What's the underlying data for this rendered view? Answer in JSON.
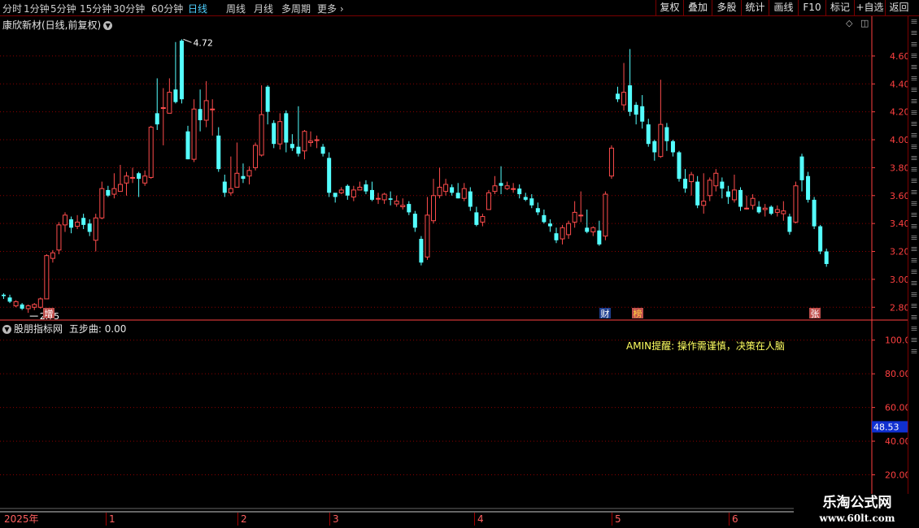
{
  "toolbar": {
    "periods": [
      "分时",
      "1分钟",
      "5分钟",
      "15分钟",
      "30分钟",
      "60分钟",
      "日线",
      "周线",
      "月线",
      "多周期",
      "更多"
    ],
    "active_period": "日线",
    "buttons": [
      "复权",
      "叠加",
      "多股",
      "统计",
      "画线",
      "F10",
      "标记",
      "+自选",
      "返回"
    ]
  },
  "main_chart": {
    "title": "康欣新材(日线,前复权)",
    "high_label": "4.72",
    "low_label": "2.75",
    "markers": [
      "增",
      "财",
      "榜",
      "张"
    ],
    "price_ticks": [
      "4.60",
      "4.40",
      "4.20",
      "4.00",
      "3.80",
      "3.60",
      "3.40",
      "3.20",
      "3.00",
      "2.80"
    ]
  },
  "indicator": {
    "title": "股朋指标网",
    "series_label": "五步曲: 0.00",
    "reminder": "AMIN提醒: 操作需谨慎，决策在人脑",
    "ticks": [
      "100.00",
      "80.00",
      "60.00",
      "40.00",
      "20.00"
    ],
    "current_value": "48.53"
  },
  "date_axis": [
    "2025年",
    "1",
    "2",
    "3",
    "4",
    "5",
    "6"
  ],
  "watermark": {
    "line1": "乐淘公式网",
    "line2": "www.60lt.com"
  },
  "colors": {
    "up": "#ff4c4c",
    "down": "#54ffff",
    "grid": "#8b0000",
    "axis": "#ff4040"
  },
  "chart_data": {
    "type": "candlestick",
    "ylim": [
      2.72,
      4.78
    ],
    "candles": [
      [
        2.89,
        2.88,
        2.9,
        2.86
      ],
      [
        2.87,
        2.84,
        2.89,
        2.83
      ],
      [
        2.81,
        2.84,
        2.85,
        2.8
      ],
      [
        2.82,
        2.79,
        2.83,
        2.78
      ],
      [
        2.79,
        2.81,
        2.82,
        2.76
      ],
      [
        2.8,
        2.82,
        2.83,
        2.78
      ],
      [
        2.8,
        2.86,
        2.87,
        2.79
      ],
      [
        2.86,
        3.17,
        3.18,
        2.86
      ],
      [
        3.15,
        3.19,
        3.21,
        3.12
      ],
      [
        3.21,
        3.39,
        3.41,
        3.18
      ],
      [
        3.39,
        3.46,
        3.48,
        3.34
      ],
      [
        3.43,
        3.37,
        3.45,
        3.33
      ],
      [
        3.38,
        3.41,
        3.46,
        3.36
      ],
      [
        3.44,
        3.39,
        3.47,
        3.36
      ],
      [
        3.4,
        3.34,
        3.43,
        3.31
      ],
      [
        3.28,
        3.44,
        3.47,
        3.2
      ],
      [
        3.44,
        3.65,
        3.7,
        3.43
      ],
      [
        3.64,
        3.6,
        3.67,
        3.59
      ],
      [
        3.61,
        3.65,
        3.76,
        3.58
      ],
      [
        3.63,
        3.68,
        3.82,
        3.63
      ],
      [
        3.69,
        3.74,
        3.77,
        3.6
      ],
      [
        3.73,
        3.73,
        3.8,
        3.69
      ],
      [
        3.76,
        3.72,
        3.77,
        3.59
      ],
      [
        3.69,
        3.74,
        3.78,
        3.67
      ],
      [
        3.73,
        4.09,
        4.1,
        3.72
      ],
      [
        4.19,
        4.11,
        4.44,
        4.07
      ],
      [
        4.23,
        4.23,
        4.37,
        3.96
      ],
      [
        4.19,
        4.34,
        4.44,
        4.19
      ],
      [
        4.36,
        4.27,
        4.7,
        4.26
      ],
      [
        4.71,
        4.29,
        4.72,
        4.26
      ],
      [
        4.06,
        3.86,
        4.1,
        3.86
      ],
      [
        3.86,
        4.22,
        4.29,
        3.84
      ],
      [
        4.22,
        4.14,
        4.36,
        4.06
      ],
      [
        4.14,
        4.28,
        4.42,
        4.09
      ],
      [
        4.22,
        4.22,
        4.29,
        4.03
      ],
      [
        4.03,
        3.79,
        4.09,
        3.77
      ],
      [
        3.7,
        3.62,
        3.75,
        3.59
      ],
      [
        3.62,
        3.65,
        3.88,
        3.6
      ],
      [
        3.66,
        3.76,
        3.98,
        3.66
      ],
      [
        3.74,
        3.72,
        3.83,
        3.69
      ],
      [
        3.74,
        3.78,
        3.81,
        3.68
      ],
      [
        3.8,
        3.96,
        3.98,
        3.78
      ],
      [
        3.89,
        4.18,
        4.39,
        3.88
      ],
      [
        4.38,
        4.2,
        4.39,
        4.11
      ],
      [
        4.12,
        3.97,
        4.14,
        3.94
      ],
      [
        3.97,
        4.13,
        4.19,
        3.93
      ],
      [
        4.19,
        3.98,
        4.21,
        3.91
      ],
      [
        3.97,
        3.94,
        4.04,
        3.92
      ],
      [
        3.95,
        3.9,
        4.24,
        3.88
      ],
      [
        3.92,
        4.06,
        4.07,
        3.86
      ],
      [
        3.98,
        3.99,
        4.06,
        3.95
      ],
      [
        4.0,
        4.0,
        4.03,
        3.94
      ],
      [
        3.95,
        3.9,
        3.97,
        3.88
      ],
      [
        3.87,
        3.62,
        3.91,
        3.59
      ],
      [
        3.62,
        3.59,
        3.61,
        3.55
      ],
      [
        3.62,
        3.64,
        3.66,
        3.61
      ],
      [
        3.67,
        3.6,
        3.68,
        3.57
      ],
      [
        3.59,
        3.64,
        3.67,
        3.56
      ],
      [
        3.64,
        3.66,
        3.7,
        3.64
      ],
      [
        3.68,
        3.63,
        3.71,
        3.61
      ],
      [
        3.64,
        3.57,
        3.7,
        3.56
      ],
      [
        3.58,
        3.58,
        3.62,
        3.54
      ],
      [
        3.57,
        3.61,
        3.62,
        3.54
      ],
      [
        3.58,
        3.57,
        3.63,
        3.53
      ],
      [
        3.54,
        3.56,
        3.6,
        3.52
      ],
      [
        3.52,
        3.53,
        3.58,
        3.5
      ],
      [
        3.54,
        3.48,
        3.56,
        3.46
      ],
      [
        3.47,
        3.37,
        3.49,
        3.34
      ],
      [
        3.29,
        3.12,
        3.31,
        3.1
      ],
      [
        3.16,
        3.46,
        3.59,
        3.14
      ],
      [
        3.42,
        3.6,
        3.72,
        3.4
      ],
      [
        3.6,
        3.66,
        3.8,
        3.58
      ],
      [
        3.63,
        3.68,
        3.72,
        3.6
      ],
      [
        3.66,
        3.62,
        3.68,
        3.6
      ],
      [
        3.62,
        3.58,
        3.69,
        3.58
      ],
      [
        3.58,
        3.65,
        3.69,
        3.56
      ],
      [
        3.63,
        3.52,
        3.66,
        3.49
      ],
      [
        3.48,
        3.39,
        3.52,
        3.38
      ],
      [
        3.41,
        3.45,
        3.47,
        3.38
      ],
      [
        3.5,
        3.62,
        3.64,
        3.5
      ],
      [
        3.63,
        3.67,
        3.74,
        3.61
      ],
      [
        3.69,
        3.67,
        3.81,
        3.61
      ],
      [
        3.65,
        3.67,
        3.7,
        3.64
      ],
      [
        3.65,
        3.65,
        3.69,
        3.62
      ],
      [
        3.65,
        3.61,
        3.68,
        3.58
      ],
      [
        3.59,
        3.57,
        3.62,
        3.56
      ],
      [
        3.58,
        3.53,
        3.61,
        3.51
      ],
      [
        3.51,
        3.48,
        3.55,
        3.46
      ],
      [
        3.46,
        3.41,
        3.5,
        3.4
      ],
      [
        3.4,
        3.38,
        3.43,
        3.34
      ],
      [
        3.33,
        3.28,
        3.37,
        3.26
      ],
      [
        3.29,
        3.37,
        3.39,
        3.25
      ],
      [
        3.32,
        3.4,
        3.42,
        3.29
      ],
      [
        3.41,
        3.48,
        3.56,
        3.37
      ],
      [
        3.46,
        3.46,
        3.63,
        3.41
      ],
      [
        3.37,
        3.34,
        3.5,
        3.33
      ],
      [
        3.34,
        3.37,
        3.38,
        3.31
      ],
      [
        3.35,
        3.25,
        3.42,
        3.24
      ],
      [
        3.31,
        3.61,
        3.63,
        3.28
      ],
      [
        3.74,
        3.94,
        3.96,
        3.72
      ],
      [
        4.33,
        4.29,
        4.38,
        4.27
      ],
      [
        4.25,
        4.34,
        4.55,
        4.21
      ],
      [
        4.39,
        4.2,
        4.65,
        4.17
      ],
      [
        4.25,
        4.18,
        4.27,
        4.11
      ],
      [
        4.24,
        4.13,
        4.32,
        4.08
      ],
      [
        4.11,
        3.97,
        4.15,
        3.95
      ],
      [
        3.99,
        3.91,
        4.0,
        3.85
      ],
      [
        3.88,
        4.11,
        4.43,
        3.87
      ],
      [
        4.09,
        3.99,
        4.12,
        3.92
      ],
      [
        3.99,
        3.91,
        4.0,
        3.88
      ],
      [
        3.91,
        3.72,
        3.92,
        3.7
      ],
      [
        3.72,
        3.65,
        3.79,
        3.62
      ],
      [
        3.7,
        3.75,
        3.77,
        3.6
      ],
      [
        3.7,
        3.53,
        3.74,
        3.51
      ],
      [
        3.53,
        3.56,
        3.76,
        3.47
      ],
      [
        3.6,
        3.71,
        3.73,
        3.56
      ],
      [
        3.67,
        3.76,
        3.79,
        3.63
      ],
      [
        3.7,
        3.65,
        3.73,
        3.58
      ],
      [
        3.63,
        3.59,
        3.67,
        3.54
      ],
      [
        3.57,
        3.64,
        3.75,
        3.55
      ],
      [
        3.64,
        3.52,
        3.66,
        3.49
      ],
      [
        3.51,
        3.51,
        3.6,
        3.5
      ],
      [
        3.53,
        3.58,
        3.61,
        3.5
      ],
      [
        3.52,
        3.48,
        3.56,
        3.47
      ],
      [
        3.5,
        3.51,
        3.54,
        3.45
      ],
      [
        3.52,
        3.47,
        3.53,
        3.46
      ],
      [
        3.48,
        3.5,
        3.53,
        3.45
      ],
      [
        3.47,
        3.49,
        3.56,
        3.42
      ],
      [
        3.45,
        3.34,
        3.47,
        3.32
      ],
      [
        3.41,
        3.67,
        3.7,
        3.4
      ],
      [
        3.88,
        3.71,
        3.9,
        3.63
      ],
      [
        3.74,
        3.57,
        3.77,
        3.55
      ],
      [
        3.57,
        3.38,
        3.59,
        3.36
      ],
      [
        3.38,
        3.2,
        3.39,
        3.18
      ],
      [
        3.2,
        3.11,
        3.22,
        3.09
      ]
    ]
  }
}
